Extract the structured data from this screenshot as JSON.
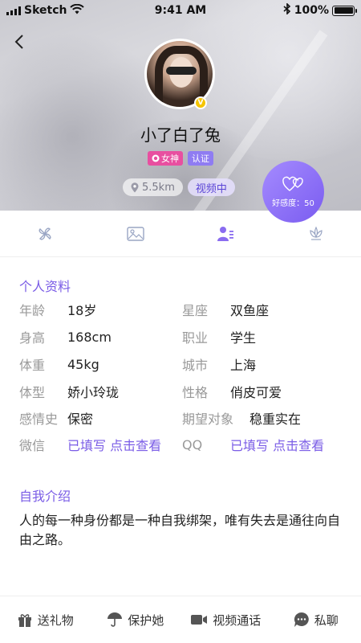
{
  "status_bar": {
    "carrier": "Sketch",
    "time": "9:41 AM",
    "battery": "100%"
  },
  "profile": {
    "nickname": "小了白了兔",
    "badges": {
      "goddess": "女神",
      "verified": "认证"
    },
    "distance": "5.5km",
    "status": "视频中",
    "favor_label": "好感度：50",
    "vip_mark": "V"
  },
  "tabs": [
    {
      "icon": "pinwheel-icon"
    },
    {
      "icon": "image-icon"
    },
    {
      "icon": "profile-info-icon",
      "active": true
    },
    {
      "icon": "gift-lotus-icon"
    }
  ],
  "personal_info": {
    "title": "个人资料",
    "rows": [
      {
        "l1": "年龄",
        "v1": "18岁",
        "l2": "星座",
        "v2": "双鱼座"
      },
      {
        "l1": "身高",
        "v1": "168cm",
        "l2": "职业",
        "v2": "学生"
      },
      {
        "l1": "体重",
        "v1": "45kg",
        "l2": "城市",
        "v2": "上海"
      },
      {
        "l1": "体型",
        "v1": "娇小玲珑",
        "l2": "性格",
        "v2": "俏皮可爱"
      },
      {
        "l1": "感情史",
        "v1": "保密",
        "l2": "期望对象",
        "v2": "稳重实在"
      },
      {
        "l1": "微信",
        "v1": "已填写 点击查看",
        "l2": "QQ",
        "v2": "已填写 点击查看"
      }
    ]
  },
  "self_intro": {
    "title": "自我介绍",
    "text": "人的每一种身份都是一种自我绑架，唯有失去是通往向自由之路。"
  },
  "bottom_bar": {
    "gift": "送礼物",
    "protect": "保护她",
    "video_call": "视频通话",
    "chat": "私聊"
  },
  "colors": {
    "accent": "#7a5ce6",
    "goddess_tag": "#e84fa0",
    "verified_tag": "#8f7cf2",
    "vip_gold": "#f5c400"
  }
}
